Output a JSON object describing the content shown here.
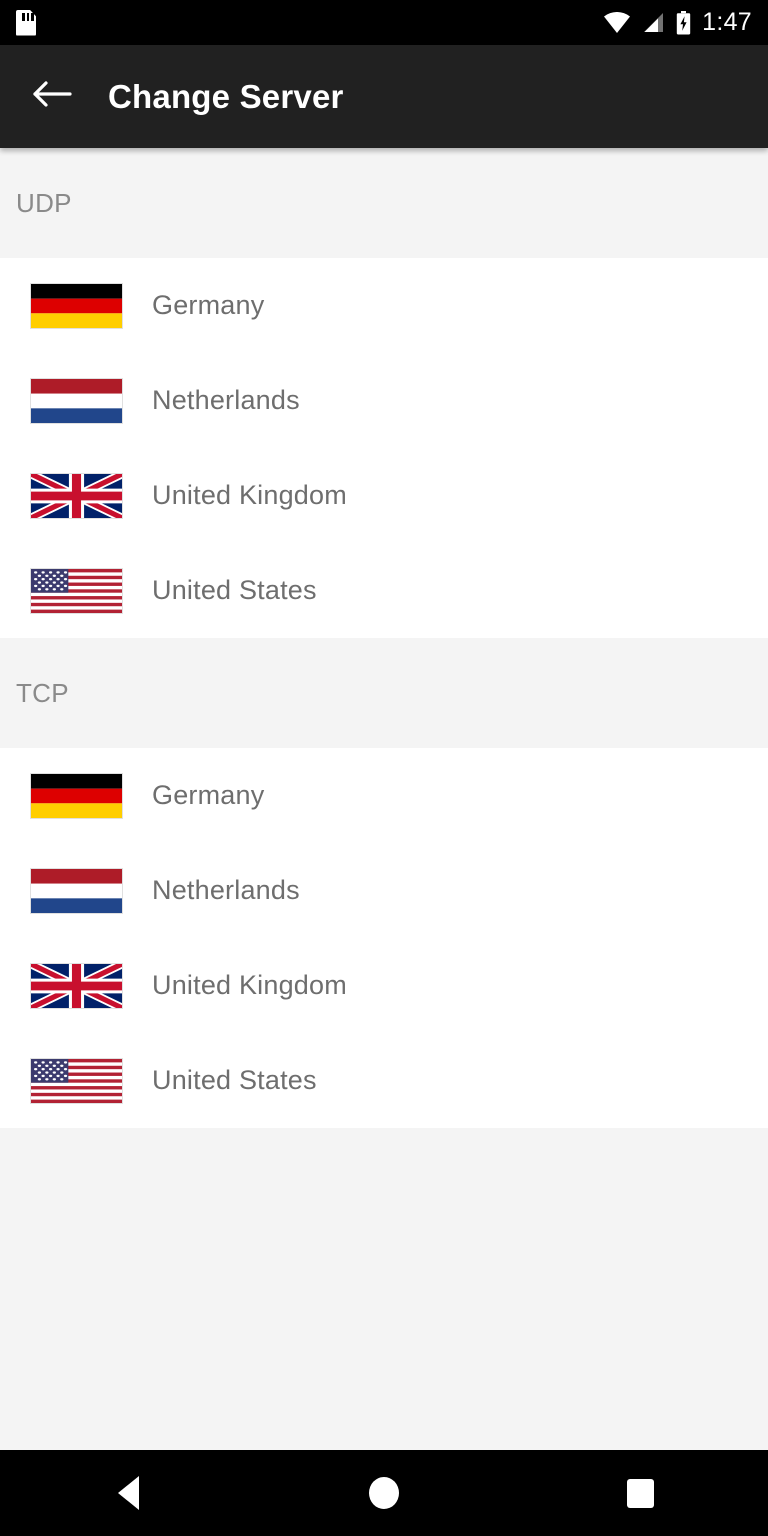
{
  "status_bar": {
    "sd_card_icon": "sd-card-icon",
    "wifi_icon": "wifi-icon",
    "signal_icon": "cell-signal-icon",
    "battery_icon": "battery-charging-icon",
    "time": "1:47"
  },
  "toolbar": {
    "back_icon": "back-arrow-icon",
    "title": "Change Server"
  },
  "sections": [
    {
      "header": "UDP",
      "rows": [
        {
          "flag": "flag-germany",
          "name": "Germany"
        },
        {
          "flag": "flag-netherlands",
          "name": "Netherlands"
        },
        {
          "flag": "flag-united-kingdom",
          "name": "United Kingdom"
        },
        {
          "flag": "flag-united-states",
          "name": "United States"
        }
      ]
    },
    {
      "header": "TCP",
      "rows": [
        {
          "flag": "flag-germany",
          "name": "Germany"
        },
        {
          "flag": "flag-netherlands",
          "name": "Netherlands"
        },
        {
          "flag": "flag-united-kingdom",
          "name": "United Kingdom"
        },
        {
          "flag": "flag-united-states",
          "name": "United States"
        }
      ]
    }
  ],
  "nav_bar": {
    "back_label": "Back",
    "home_label": "Home",
    "recents_label": "Recents"
  },
  "colors": {
    "status_bar_bg": "#000000",
    "toolbar_bg": "#212121",
    "page_bg": "#f4f4f4",
    "list_bg": "#ffffff",
    "section_label": "#8a8a8a",
    "row_label": "#6e6e6e",
    "nav_bar_bg": "#000000"
  }
}
